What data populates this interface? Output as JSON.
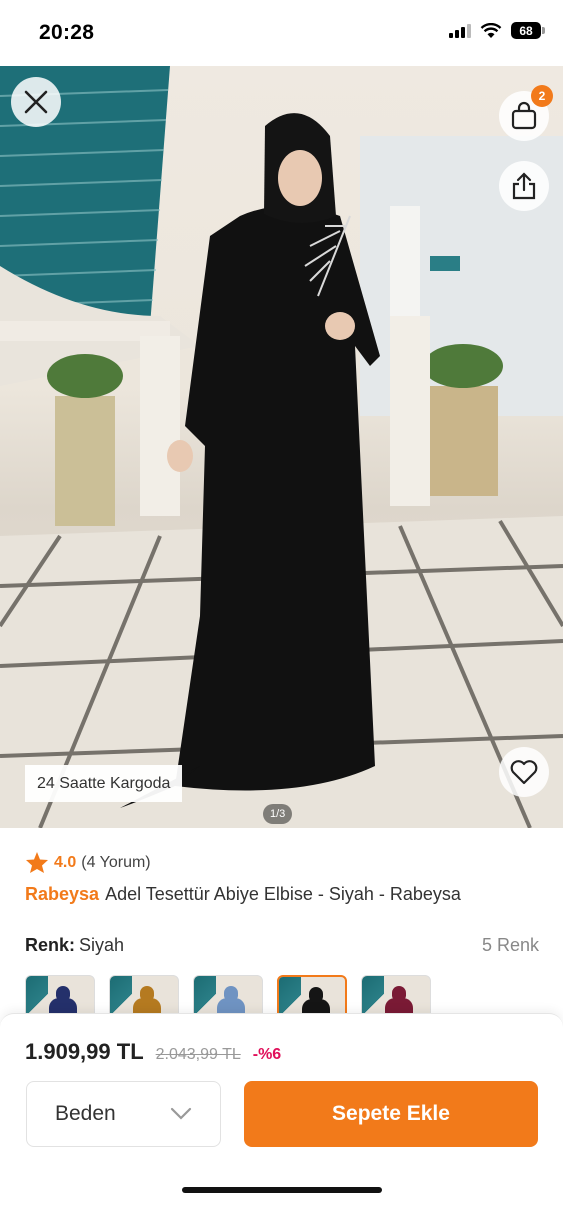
{
  "status_bar": {
    "time": "20:28",
    "battery": "68"
  },
  "hero": {
    "cart_badge_count": "2",
    "cargo_badge": "24 Saatte Kargoda",
    "page_indicator": "1/3"
  },
  "product": {
    "rating": "4.0",
    "review_count": "(4 Yorum)",
    "brand": "Rabeysa",
    "title": "Adel Tesettür Abiye Elbise - Siyah - Rabeysa",
    "color_label": "Renk:",
    "color_value": "Siyah",
    "color_count": "5 Renk",
    "variant_colors": [
      "#24306b",
      "#b57a20",
      "#6f93c2",
      "#151515",
      "#7a1a35"
    ]
  },
  "bottom": {
    "price": "1.909,99 TL",
    "old_price": "2.043,99 TL",
    "discount": "-%6",
    "size_label": "Beden",
    "add_to_cart": "Sepete Ekle"
  },
  "colors": {
    "accent": "#f27a1a",
    "discount": "#e0105a"
  }
}
